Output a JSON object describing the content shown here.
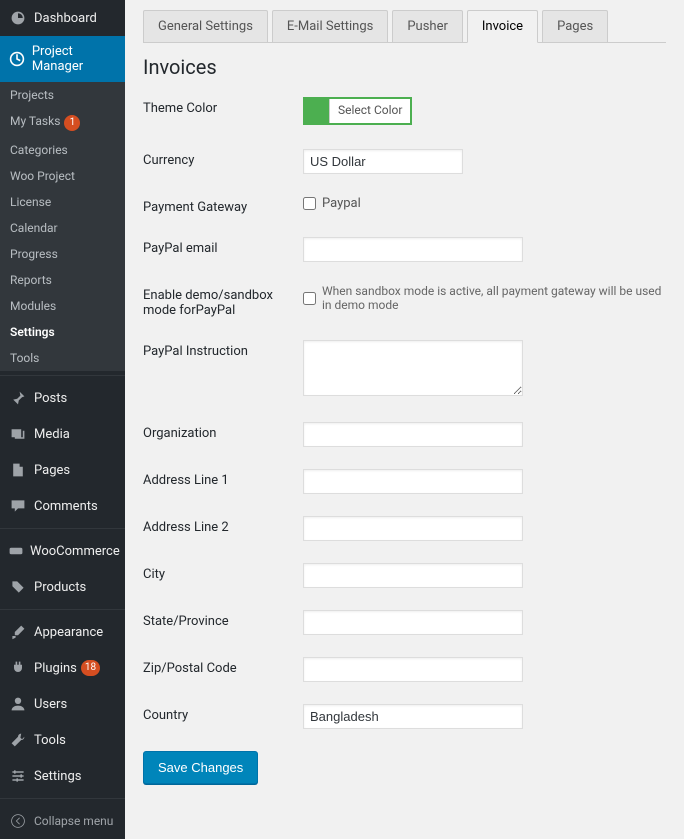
{
  "sidebar": {
    "top": [
      {
        "label": "Dashboard"
      },
      {
        "label": "Project Manager"
      }
    ],
    "submenu": [
      {
        "label": "Projects"
      },
      {
        "label": "My Tasks",
        "badge": "1"
      },
      {
        "label": "Categories"
      },
      {
        "label": "Woo Project"
      },
      {
        "label": "License"
      },
      {
        "label": "Calendar"
      },
      {
        "label": "Progress"
      },
      {
        "label": "Reports"
      },
      {
        "label": "Modules"
      },
      {
        "label": "Settings"
      },
      {
        "label": "Tools"
      }
    ],
    "bottom": [
      {
        "label": "Posts"
      },
      {
        "label": "Media"
      },
      {
        "label": "Pages"
      },
      {
        "label": "Comments"
      },
      {
        "label": "WooCommerce"
      },
      {
        "label": "Products"
      },
      {
        "label": "Appearance"
      },
      {
        "label": "Plugins",
        "badge": "18"
      },
      {
        "label": "Users"
      },
      {
        "label": "Tools"
      },
      {
        "label": "Settings"
      }
    ],
    "collapse": "Collapse menu"
  },
  "tabs": [
    {
      "label": "General Settings"
    },
    {
      "label": "E-Mail Settings"
    },
    {
      "label": "Pusher"
    },
    {
      "label": "Invoice"
    },
    {
      "label": "Pages"
    }
  ],
  "heading": "Invoices",
  "form": {
    "theme_color": {
      "label": "Theme Color",
      "button": "Select Color",
      "color": "#4caf50"
    },
    "currency": {
      "label": "Currency",
      "value": "US Dollar"
    },
    "gateway": {
      "label": "Payment Gateway",
      "option": "Paypal"
    },
    "paypal_email": {
      "label": "PayPal email",
      "value": ""
    },
    "sandbox": {
      "label": "Enable demo/sandbox mode forPayPal",
      "hint": "When sandbox mode is active, all payment gateway will be used in demo mode"
    },
    "instruction": {
      "label": "PayPal Instruction",
      "value": ""
    },
    "org": {
      "label": "Organization",
      "value": ""
    },
    "addr1": {
      "label": "Address Line 1",
      "value": ""
    },
    "addr2": {
      "label": "Address Line 2",
      "value": ""
    },
    "city": {
      "label": "City",
      "value": ""
    },
    "state": {
      "label": "State/Province",
      "value": ""
    },
    "zip": {
      "label": "Zip/Postal Code",
      "value": ""
    },
    "country": {
      "label": "Country",
      "value": "Bangladesh"
    }
  },
  "save": "Save Changes"
}
